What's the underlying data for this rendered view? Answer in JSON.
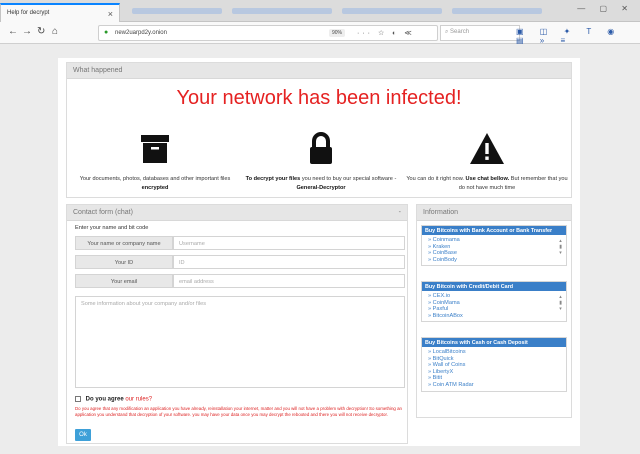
{
  "browser": {
    "tab_title": "Help for decrypt",
    "tab_close": "×",
    "url": "new2uarpd2y.onion",
    "zoom": "90%",
    "search_placeholder": "Search",
    "page_actions": "··· ☆ ◐ ≪",
    "window_controls": "— ▢ ✕",
    "toolbar_icons": "▣ ◫ ✦ T ◉ ▤ » ≡"
  },
  "what_happened": {
    "header": "What happened",
    "headline": "Your network has been infected!",
    "col1": {
      "icon": "archive-box-icon",
      "text": "Your documents, photos, databases and other important files",
      "bold": "encrypted"
    },
    "col2": {
      "icon": "padlock-icon",
      "bold": "To decrypt your files",
      "text": "you need to buy our special software -",
      "product": "General-Decryptor"
    },
    "col3": {
      "icon": "warning-triangle-icon",
      "text1": "You can do it right now.",
      "bold": "Use chat bellow.",
      "text2": "But remember that you do not have much time"
    }
  },
  "contact": {
    "header": "Contact form (chat)",
    "collapse": "-",
    "instruction": "Enter your name and bit code",
    "name_label": "Your name or company name",
    "name_placeholder": "Username",
    "id_label": "Your ID",
    "id_placeholder": "ID",
    "email_label": "Your email",
    "email_placeholder": "email address",
    "info_placeholder": "Some information about your company and/or files",
    "agree_text": "Do you agree",
    "agree_rules": "our rules?",
    "warning": "Do you agree that any modification an application you have already, reinstallation your internet, matter and you will not have a problem with decryption! So something an application you understand that decryption of your software. you may have your data once you may decrypt the rebooted and there you will not receive decryptor.",
    "ok_label": "Ok"
  },
  "information": {
    "header": "Information",
    "groups": [
      {
        "title": "Buy Bitcoins with Bank Account or Bank Transfer",
        "items": [
          "Coinmama",
          "Kraken",
          "CoinBase",
          "CoinBody"
        ]
      },
      {
        "title": "Buy Bitcoin with Credit/Debit Card",
        "items": [
          "CEX.io",
          "CoinMama",
          "Paxful",
          "BitcoinABox"
        ]
      },
      {
        "title": "Buy Bitcoins with Cash or Cash Deposit",
        "items": [
          "LocalBitcoins",
          "BitQuick",
          "Wall of Coins",
          "LibertyX",
          "Bitit",
          "Coin ATM Radar"
        ]
      }
    ]
  }
}
